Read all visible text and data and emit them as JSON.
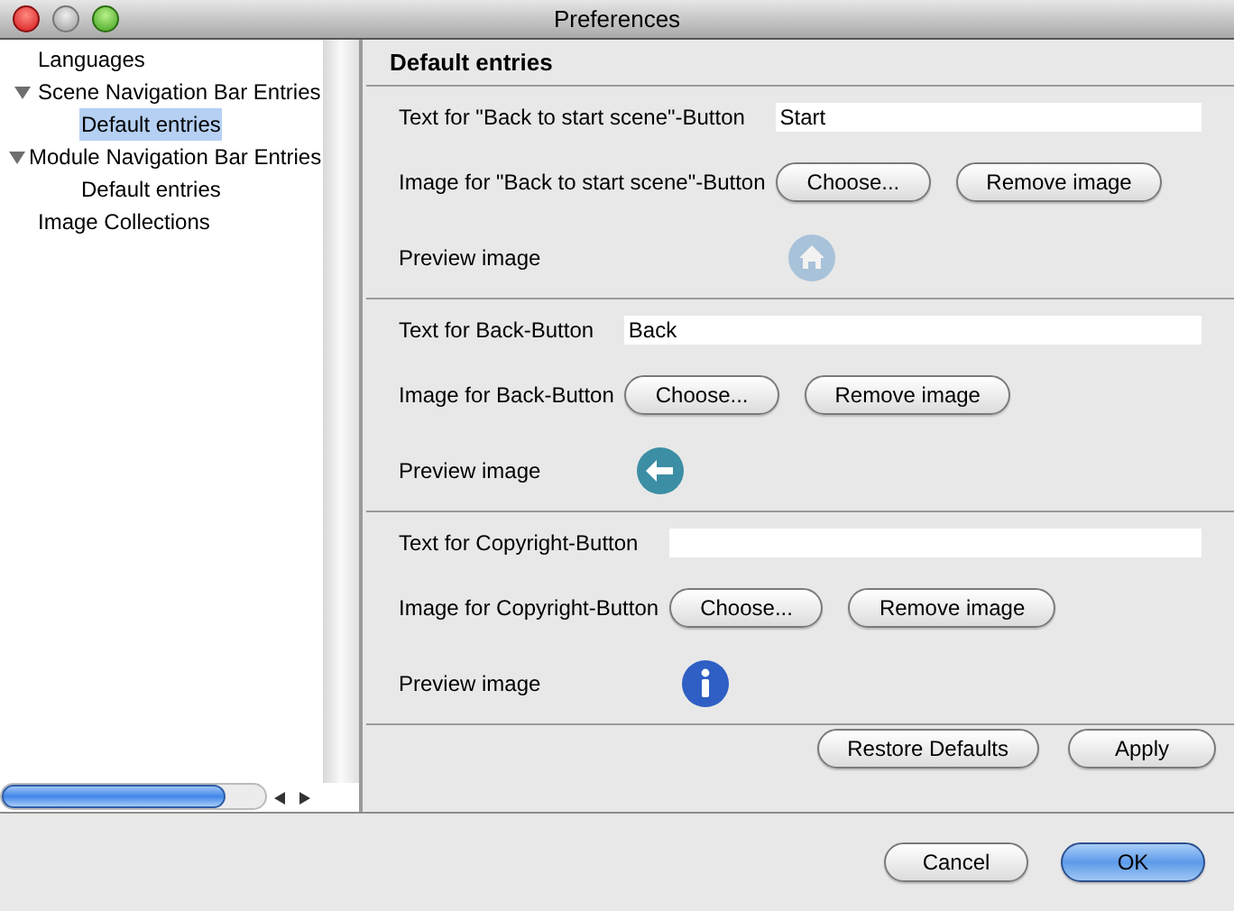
{
  "window": {
    "title": "Preferences"
  },
  "sidebar": {
    "items": [
      {
        "label": "Languages",
        "selected": false
      },
      {
        "label": "Scene Navigation Bar Entries",
        "expanded": true,
        "selected": false,
        "children": [
          {
            "label": "Default entries",
            "selected": true
          }
        ]
      },
      {
        "label": "Module Navigation Bar Entries",
        "expanded": true,
        "selected": false,
        "children": [
          {
            "label": "Default entries",
            "selected": false
          }
        ]
      },
      {
        "label": "Image Collections",
        "selected": false
      }
    ]
  },
  "panel": {
    "title": "Default entries",
    "sections": [
      {
        "text_label": "Text for \"Back to start scene\"-Button",
        "value": "Start",
        "image_label": "Image for \"Back to start scene\"-Button",
        "choose": "Choose...",
        "remove": "Remove image",
        "preview_label": "Preview image",
        "preview": {
          "kind": "home",
          "disabled": true
        }
      },
      {
        "text_label": "Text for Back-Button",
        "value": "Back",
        "image_label": "Image for Back-Button",
        "choose": "Choose...",
        "remove": "Remove image",
        "preview_label": "Preview image",
        "preview": {
          "kind": "back",
          "disabled": false
        }
      },
      {
        "text_label": "Text for Copyright-Button",
        "image_label": "Image for Copyright-Button",
        "choose": "Choose...",
        "remove": "Remove image",
        "preview_label": "Preview image",
        "preview": {
          "kind": "info",
          "disabled": false
        }
      }
    ],
    "buttons": [
      "Restore Defaults",
      "Apply"
    ]
  },
  "footer": {
    "buttons": [
      {
        "label": "Cancel",
        "default": false
      },
      {
        "label": "OK",
        "default": true
      }
    ]
  }
}
